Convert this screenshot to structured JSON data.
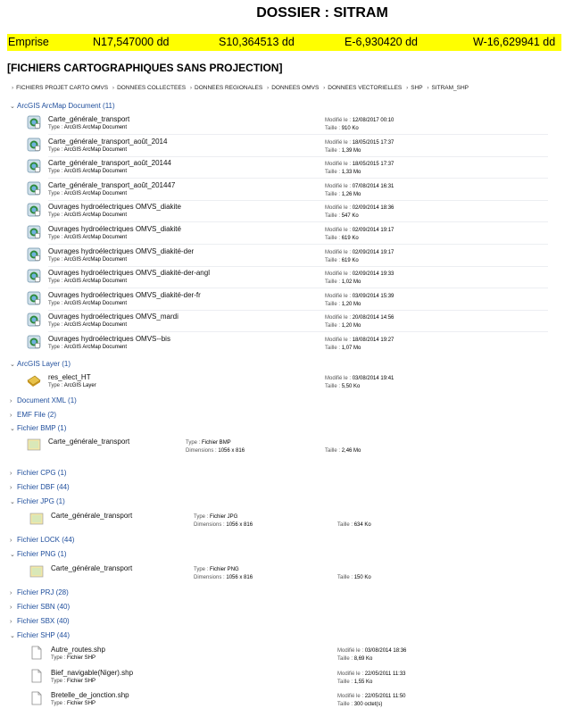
{
  "title": "DOSSIER : SITRAM",
  "emprise": {
    "label": "Emprise",
    "north": "N17,547000 dd",
    "south": "S10,364513 dd",
    "east": "E-6,930420 dd",
    "west": "W-16,629941 dd"
  },
  "subtitle": "[FICHIERS CARTOGRAPHIQUES SANS PROJECTION]",
  "breadcrumb": [
    "FICHIERS PROJET CARTO OMVS",
    "DONNEES COLLECTEES",
    "DONNEES REGIONALES",
    "DONNEES OMVS",
    "DONNEES VECTORIELLES",
    "SHP",
    "SITRAM_SHP"
  ],
  "labels": {
    "type": "Type :",
    "modified": "Modifié le :",
    "size": "Taille :",
    "dimensions": "Dimensions :"
  },
  "groups": {
    "arcmap": "ArcGIS ArcMap Document (11)",
    "layer": "ArcGIS Layer (1)",
    "xml": "Document XML (1)",
    "emf": "EMF File (2)",
    "bmp": "Fichier BMP (1)",
    "cpg": "Fichier CPG (1)",
    "dbf": "Fichier DBF (44)",
    "jpg": "Fichier JPG (1)",
    "lock": "Fichier LOCK (44)",
    "png": "Fichier PNG (1)",
    "prj": "Fichier PRJ (28)",
    "sbn": "Fichier SBN (40)",
    "sbx": "Fichier SBX (40)",
    "shp": "Fichier SHP (44)"
  },
  "arcmap_files": [
    {
      "name": "Carte_générale_transport",
      "type": "ArcGIS ArcMap Document",
      "modified": "12/08/2017 00:10",
      "size": "910 Ko"
    },
    {
      "name": "Carte_générale_transport_août_2014",
      "type": "ArcGIS ArcMap Document",
      "modified": "18/05/2015 17:37",
      "size": "1,39 Mo"
    },
    {
      "name": "Carte_générale_transport_août_20144",
      "type": "ArcGIS ArcMap Document",
      "modified": "18/05/2015 17:37",
      "size": "1,33 Mo"
    },
    {
      "name": "Carte_générale_transport_août_201447",
      "type": "ArcGIS ArcMap Document",
      "modified": "07/08/2014 16:31",
      "size": "1,26 Mo"
    },
    {
      "name": "Ouvrages hydroélectriques OMVS_diakite",
      "type": "ArcGIS ArcMap Document",
      "modified": "02/09/2014 18:36",
      "size": "547 Ko"
    },
    {
      "name": "Ouvrages hydroélectriques OMVS_diakité",
      "type": "ArcGIS ArcMap Document",
      "modified": "02/09/2014 19:17",
      "size": "619 Ko"
    },
    {
      "name": "Ouvrages hydroélectriques OMVS_diakité-der",
      "type": "ArcGIS ArcMap Document",
      "modified": "02/09/2014 19:17",
      "size": "619 Ko"
    },
    {
      "name": "Ouvrages hydroélectriques OMVS_diakité-der-angl",
      "type": "ArcGIS ArcMap Document",
      "modified": "02/09/2014 19:33",
      "size": "1,02 Mo"
    },
    {
      "name": "Ouvrages hydroélectriques OMVS_diakité-der-fr",
      "type": "ArcGIS ArcMap Document",
      "modified": "03/09/2014 15:39",
      "size": "1,20 Mo"
    },
    {
      "name": "Ouvrages hydroélectriques OMVS_mardi",
      "type": "ArcGIS ArcMap Document",
      "modified": "20/08/2014 14:56",
      "size": "1,20 Mo"
    },
    {
      "name": "Ouvrages hydroélectriques OMVS--bis",
      "type": "ArcGIS ArcMap Document",
      "modified": "18/08/2014 19:27",
      "size": "1,07 Mo"
    }
  ],
  "layer_file": {
    "name": "res_elect_HT",
    "type": "ArcGIS Layer",
    "modified": "03/08/2014 19:41",
    "size": "5,50 Ko"
  },
  "bmp_file": {
    "name": "Carte_générale_transport",
    "type": "Fichier BMP",
    "dimensions": "1056 x 816",
    "size": "2,46 Mo"
  },
  "jpg_file": {
    "name": "Carte_générale_transport",
    "type": "Fichier JPG",
    "dimensions": "1056 x 816",
    "size": "634 Ko"
  },
  "png_file": {
    "name": "Carte_générale_transport",
    "type": "Fichier PNG",
    "dimensions": "1056 x 816",
    "size": "150 Ko"
  },
  "shp_files": [
    {
      "name": "Autre_routes.shp",
      "type": "Fichier SHP",
      "modified": "03/08/2014 18:36",
      "size": "8,69 Ko"
    },
    {
      "name": "Bief_navigable(Niger).shp",
      "type": "Fichier SHP",
      "modified": "22/05/2011 11:33",
      "size": "1,55 Ko"
    },
    {
      "name": "Bretelle_de_jonction.shp",
      "type": "Fichier SHP",
      "modified": "22/05/2011 11:50",
      "size": "300 octet(s)"
    }
  ]
}
